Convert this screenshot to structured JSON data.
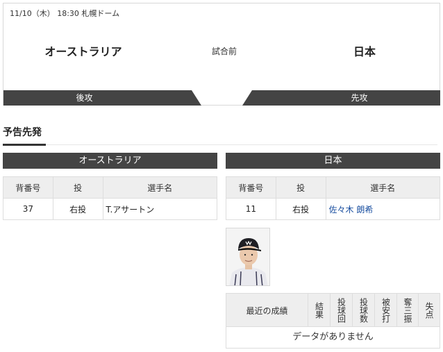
{
  "match": {
    "info": "11/10（木） 18:30 札幌ドーム",
    "away_team": "オーストラリア",
    "home_team": "日本",
    "status": "試合前",
    "away_bat": "後攻",
    "home_bat": "先攻"
  },
  "section": {
    "title": "予告先発"
  },
  "columns": {
    "number": "背番号",
    "throws": "投",
    "name": "選手名"
  },
  "away_pitcher": {
    "team": "オーストラリア",
    "number": "37",
    "throws": "右投",
    "name": "T.アサートン"
  },
  "home_pitcher": {
    "team": "日本",
    "number": "11",
    "throws": "右投",
    "name": "佐々木 朗希"
  },
  "recent_stats": {
    "headers": [
      "最近の成績",
      "結果",
      "投球回",
      "投球数",
      "被安打",
      "奪三振",
      "失点"
    ],
    "empty_message": "データがありません"
  },
  "colors": {
    "bar": "#444444",
    "link": "#1a4fa0",
    "header_bg": "#eeeeee"
  }
}
